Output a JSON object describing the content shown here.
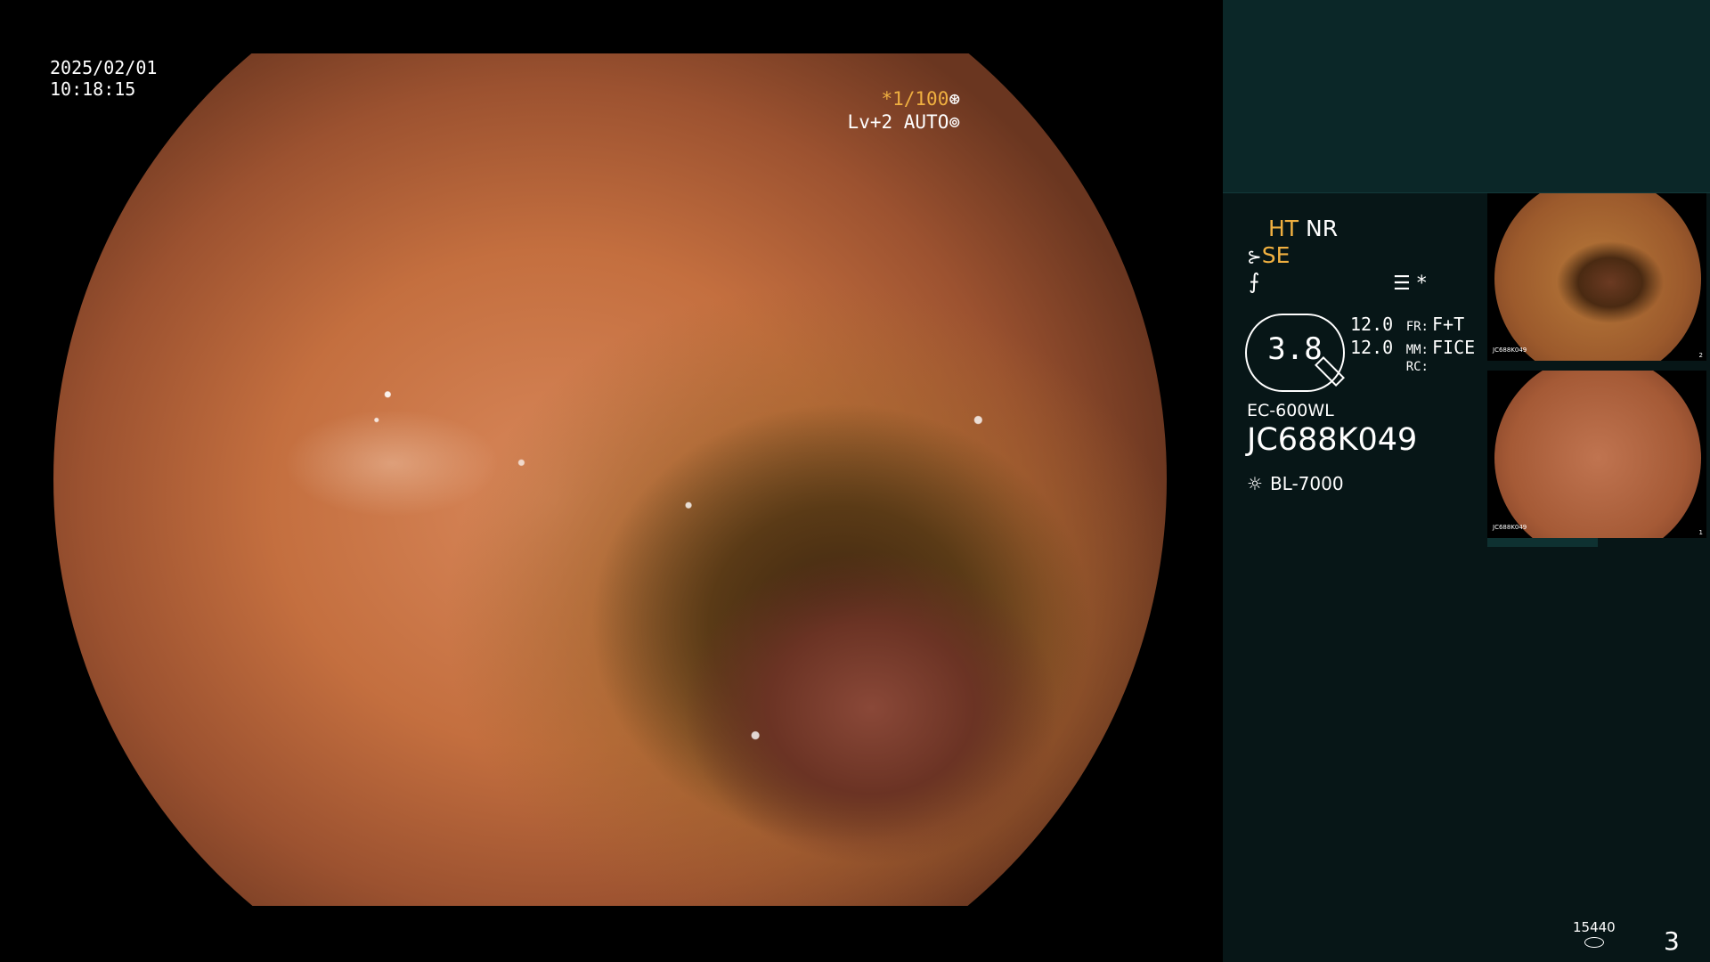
{
  "image": {
    "date": "2025/02/01",
    "time": "10:18:15"
  },
  "shutter": {
    "speed": "*1/100",
    "level": "Lv+2 AUTO"
  },
  "panel": {
    "ht": "HT",
    "nr": "NR",
    "se": "SE",
    "gauge_value": "3.8",
    "settings": [
      {
        "num": "12.0",
        "label": "FR:",
        "value": "F+T"
      },
      {
        "num": "12.0",
        "label": "MM:",
        "value": "FICE"
      },
      {
        "num": "",
        "label": "RC:",
        "value": ""
      }
    ],
    "model": "EC-600WL",
    "serial": "JC688K049",
    "light_source": "BL-7000"
  },
  "thumbnails": [
    {
      "caption": "JC688K049",
      "index": "2"
    },
    {
      "caption": "JC688K049",
      "index": "1"
    }
  ],
  "footer": {
    "count": "15440",
    "page": "3"
  },
  "colors": {
    "accent_orange": "#f0b040",
    "panel_bg": "#071617",
    "panel_top": "#0b2728"
  }
}
